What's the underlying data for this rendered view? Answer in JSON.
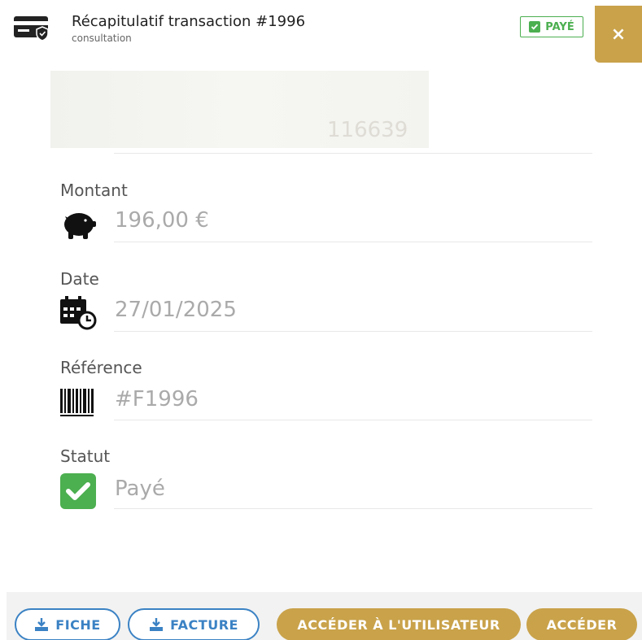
{
  "header": {
    "title": "Récapitulatif transaction #1996",
    "subtitle": "consultation",
    "status_badge": "PAYÉ",
    "close_label": "×",
    "card_icon": "credit-card-shield-icon"
  },
  "blurred_field": {
    "partial_value": "116639"
  },
  "fields": {
    "amount": {
      "label": "Montant",
      "value": "196,00 €",
      "icon": "piggy-bank-icon"
    },
    "date": {
      "label": "Date",
      "value": "27/01/2025",
      "icon": "calendar-clock-icon"
    },
    "reference": {
      "label": "Référence",
      "value": "#F1996",
      "icon": "barcode-icon"
    },
    "status": {
      "label": "Statut",
      "value": "Payé",
      "icon": "check-square-icon"
    }
  },
  "footer": {
    "fiche_label": "FICHE",
    "facture_label": "FACTURE",
    "access_user_label": "ACCÉDER À L'UTILISATEUR",
    "access_label": "ACCÉDER"
  },
  "colors": {
    "gold": "#c9a24a",
    "blue": "#3b82c4",
    "green": "#4caf50"
  }
}
